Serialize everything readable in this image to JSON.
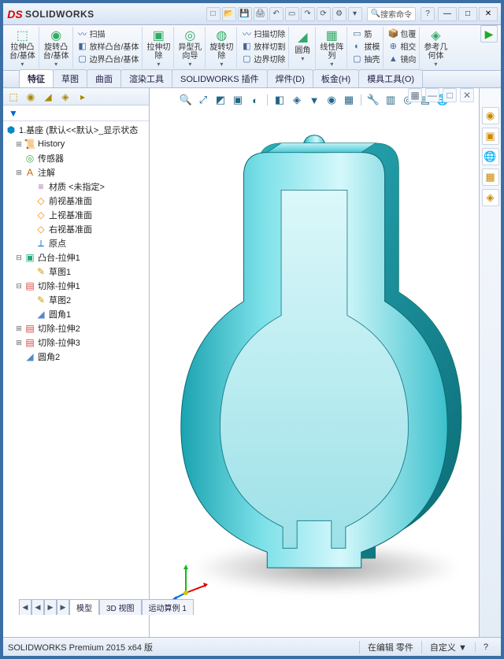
{
  "title": "SOLIDWORKS",
  "search": {
    "icon": "🔍",
    "label": "搜索命令"
  },
  "help_icon": "?",
  "win": {
    "min": "—",
    "max": "□",
    "close": "✕"
  },
  "ribbon": {
    "groups": [
      {
        "icon": "⬚",
        "label": "拉伸凸\n台/基体",
        "dd": true
      },
      {
        "icon": "◉",
        "label": "旋转凸\n台/基体",
        "dd": true
      },
      {
        "rows": [
          {
            "icon": "〰",
            "label": "扫描"
          },
          {
            "icon": "◧",
            "label": "放样凸台/基体"
          },
          {
            "icon": "▢",
            "label": "边界凸台/基体"
          }
        ]
      },
      {
        "icon": "▣",
        "label": "拉伸切\n除",
        "dd": true
      },
      {
        "icon": "◎",
        "label": "异型孔\n向导",
        "dd": true
      },
      {
        "icon": "◍",
        "label": "旋转切\n除",
        "dd": true
      },
      {
        "rows": [
          {
            "icon": "〰",
            "label": "扫描切除"
          },
          {
            "icon": "◧",
            "label": "放样切割"
          },
          {
            "icon": "▢",
            "label": "边界切除"
          }
        ]
      },
      {
        "icon": "◢",
        "label": "圆角",
        "dd": true
      },
      {
        "icon": "▦",
        "label": "线性阵\n列",
        "dd": true
      },
      {
        "rows": [
          {
            "icon": "▭",
            "label": "筋"
          },
          {
            "icon": "◐",
            "label": "拔模"
          },
          {
            "icon": "▢",
            "label": "抽壳"
          }
        ]
      },
      {
        "rows": [
          {
            "icon": "📦",
            "label": "包覆"
          },
          {
            "icon": "⊕",
            "label": "相交"
          },
          {
            "icon": "▲",
            "label": "镜向"
          }
        ]
      },
      {
        "icon": "◈",
        "label": "参考几\n何体",
        "dd": true
      }
    ]
  },
  "cmdtabs": [
    "特征",
    "草图",
    "曲面",
    "渲染工具",
    "SOLIDWORKS 插件",
    "焊件(D)",
    "板金(H)",
    "模具工具(O)"
  ],
  "left_toolbar_icons": [
    "⬚",
    "◉",
    "◢",
    "◈",
    "▸"
  ],
  "filter_icon": "▼",
  "tree": {
    "root": "1.基座  (默认<<默认>_显示状态",
    "items": [
      {
        "exp": "+",
        "icon": "history",
        "label": "History"
      },
      {
        "exp": "",
        "icon": "sensor",
        "label": "传感器"
      },
      {
        "exp": "+",
        "icon": "annot",
        "label": "注解"
      },
      {
        "exp": "",
        "icon": "mat",
        "label": "材质 <未指定>",
        "indent": 1
      },
      {
        "exp": "",
        "icon": "plane",
        "label": "前视基准面",
        "indent": 1
      },
      {
        "exp": "",
        "icon": "plane",
        "label": "上视基准面",
        "indent": 1
      },
      {
        "exp": "",
        "icon": "plane",
        "label": "右视基准面",
        "indent": 1
      },
      {
        "exp": "",
        "icon": "origin",
        "label": "原点",
        "indent": 1
      },
      {
        "exp": "-",
        "icon": "boss",
        "label": "凸台-拉伸1"
      },
      {
        "exp": "",
        "icon": "sketch",
        "label": "草图1",
        "indent": 1
      },
      {
        "exp": "-",
        "icon": "cut",
        "label": "切除-拉伸1"
      },
      {
        "exp": "",
        "icon": "sketch",
        "label": "草图2",
        "indent": 1
      },
      {
        "exp": "",
        "icon": "fillet",
        "label": "圆角1",
        "indent": 1
      },
      {
        "exp": "+",
        "icon": "cut",
        "label": "切除-拉伸2"
      },
      {
        "exp": "+",
        "icon": "cut",
        "label": "切除-拉伸3"
      },
      {
        "exp": "",
        "icon": "fillet",
        "label": "圆角2"
      }
    ]
  },
  "view_toolbar": [
    "🔍",
    "⤢",
    "◩",
    "▣",
    "◐",
    "◧",
    "◈",
    "▼",
    "◉",
    "▦",
    "🔧",
    "▥",
    "◎",
    "▤",
    "🌐"
  ],
  "rightbar": [
    "◉",
    "▣",
    "🌐",
    "▦",
    "◈"
  ],
  "lower_tabs": {
    "arrows": [
      "◀",
      "◀",
      "▶",
      "▶"
    ],
    "tabs": [
      "模型",
      "3D 视图",
      "运动算例 1"
    ]
  },
  "status": {
    "left": "SOLIDWORKS Premium 2015 x64 版",
    "mid": "在编辑 零件",
    "right": "自定义",
    "arrow": "▼",
    "q": "?"
  },
  "run": "▶"
}
